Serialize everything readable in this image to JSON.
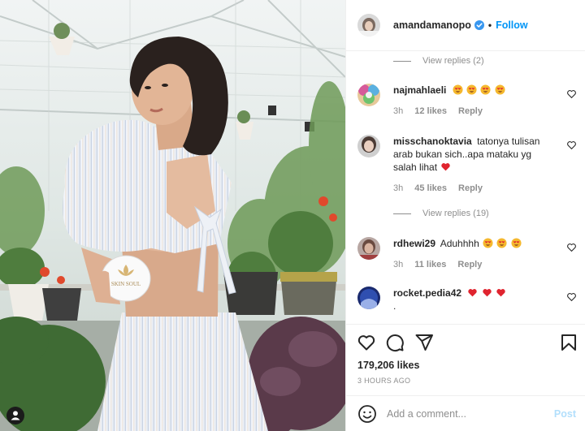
{
  "post": {
    "author": "amandamanopo",
    "follow_label": "Follow",
    "separator": "•",
    "likes": "179,206 likes",
    "time_ago": "3 HOURS AGO"
  },
  "product_label": "SKIN SOUL",
  "comments": [
    {
      "type": "view_replies",
      "label": "View replies (2)"
    },
    {
      "user": "najmahlaeli",
      "text": "",
      "emojis": [
        "smiling-face-with-heart-eyes",
        "smiling-face-with-heart-eyes",
        "smiling-face-with-heart-eyes",
        "smiling-face-with-heart-eyes"
      ],
      "age": "3h",
      "likes": "12 likes",
      "reply": "Reply"
    },
    {
      "user": "misschanoktavia",
      "text": "tatonya tulisan arab bukan sich..apa mataku yg salah lihat",
      "emojis": [
        "red-heart"
      ],
      "age": "3h",
      "likes": "45 likes",
      "reply": "Reply"
    },
    {
      "type": "view_replies",
      "label": "View replies (19)"
    },
    {
      "user": "rdhewi29",
      "text": "Aduhhhh",
      "emojis": [
        "smiling-face-with-heart-eyes",
        "smiling-face-with-heart-eyes",
        "smiling-face-with-heart-eyes"
      ],
      "age": "3h",
      "likes": "11 likes",
      "reply": "Reply"
    },
    {
      "user": "rocket.pedia42",
      "text": "",
      "emojis": [
        "red-heart",
        "red-heart",
        "red-heart"
      ],
      "second_line": ".",
      "age": "",
      "likes": "",
      "reply": ""
    }
  ],
  "add_comment": {
    "placeholder": "Add a comment...",
    "post_label": "Post"
  },
  "icons": {
    "verified": "verified-badge-icon",
    "like": "heart-icon",
    "comment": "comment-icon",
    "share": "send-icon",
    "save": "bookmark-icon",
    "emoji": "smiley-icon",
    "tagged": "user-tag-icon"
  },
  "colors": {
    "accent": "#0095f6",
    "post_disabled": "#b2dffc",
    "muted": "#8e8e8e",
    "text": "#262626"
  }
}
